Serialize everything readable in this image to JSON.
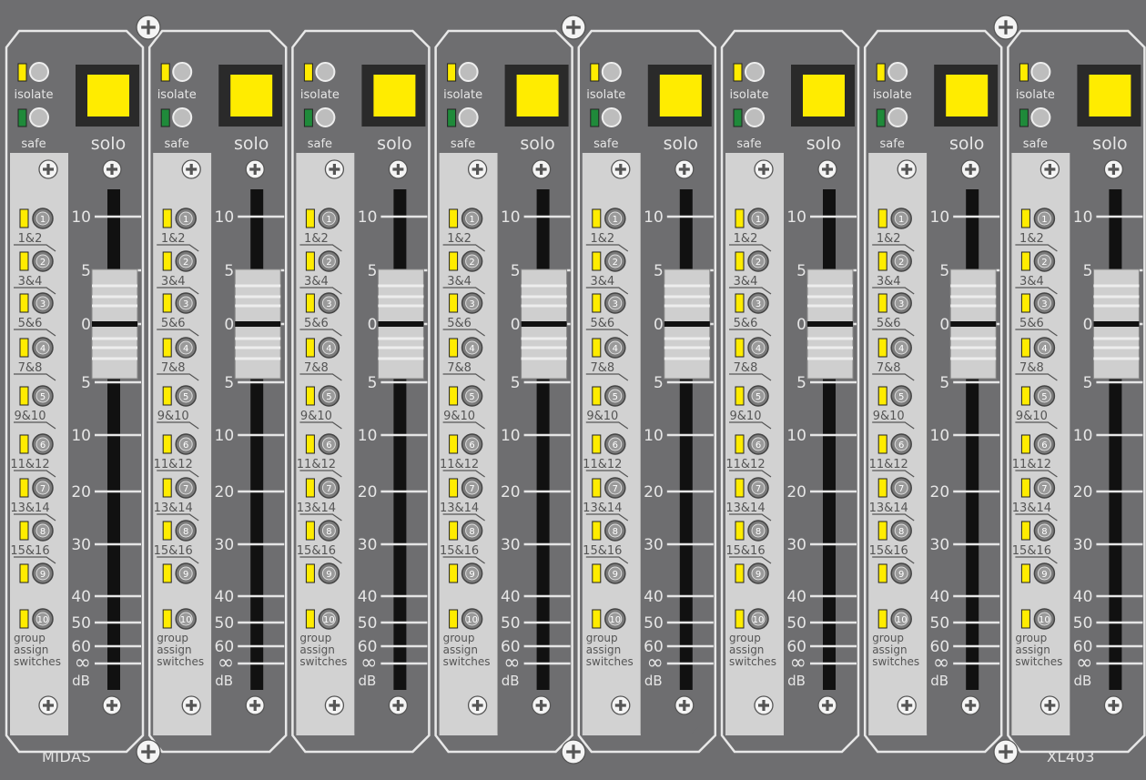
{
  "console": {
    "brand_left": "MIDAS",
    "brand_right": "XL403"
  },
  "strip": {
    "isolate_label": "isolate",
    "safe_label": "safe",
    "solo_label": "solo",
    "group_assign_label": [
      "group",
      "assign",
      "switches"
    ],
    "db_unit": "dB",
    "group_buttons": [
      {
        "number": "1",
        "pair": "1&2"
      },
      {
        "number": "2",
        "pair": "3&4"
      },
      {
        "number": "3",
        "pair": "5&6"
      },
      {
        "number": "4",
        "pair": "7&8"
      },
      {
        "number": "5",
        "pair": "9&10"
      },
      {
        "number": "6",
        "pair": "11&12"
      },
      {
        "number": "7",
        "pair": "13&14"
      },
      {
        "number": "8",
        "pair": "15&16"
      },
      {
        "number": "9",
        "pair": ""
      },
      {
        "number": "10",
        "pair": ""
      }
    ],
    "fader_scale": [
      "10",
      "5",
      "0",
      "5",
      "10",
      "20",
      "30",
      "40",
      "50",
      "60",
      "∞"
    ]
  },
  "channels": [
    {
      "fader_level_db": 0,
      "isolate_led": "yellow",
      "safe_led": "green",
      "solo_lit": true
    },
    {
      "fader_level_db": 0,
      "isolate_led": "yellow",
      "safe_led": "green",
      "solo_lit": true
    },
    {
      "fader_level_db": 0,
      "isolate_led": "yellow",
      "safe_led": "green",
      "solo_lit": true
    },
    {
      "fader_level_db": 0,
      "isolate_led": "yellow",
      "safe_led": "green",
      "solo_lit": true
    },
    {
      "fader_level_db": 0,
      "isolate_led": "yellow",
      "safe_led": "green",
      "solo_lit": true
    },
    {
      "fader_level_db": 0,
      "isolate_led": "yellow",
      "safe_led": "green",
      "solo_lit": true
    },
    {
      "fader_level_db": 0,
      "isolate_led": "yellow",
      "safe_led": "green",
      "solo_lit": true
    },
    {
      "fader_level_db": 0,
      "isolate_led": "yellow",
      "safe_led": "green",
      "solo_lit": true
    }
  ],
  "colors": {
    "panel": "#6e6e70",
    "strip_light": "#d2d2d2",
    "strip_dark": "#6e6e70",
    "solo_yellow": "#ffec00",
    "led_yellow": "#ffec00",
    "led_green": "#1f8a3a",
    "fader_cap": "#cfcfcf"
  }
}
